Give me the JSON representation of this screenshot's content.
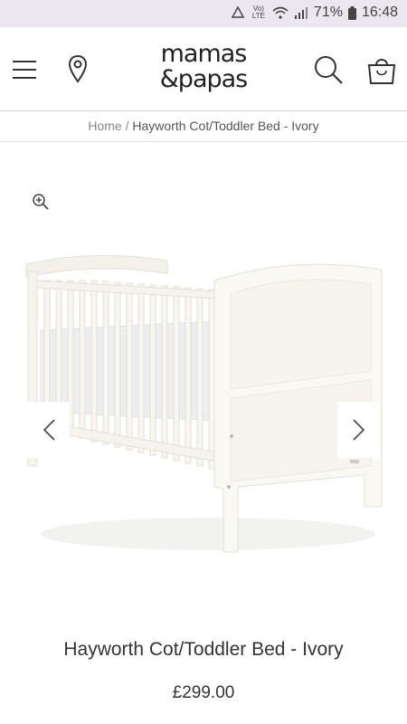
{
  "status_bar": {
    "battery_percent": "71%",
    "time": "16:48",
    "network_label": "Vo) LTE"
  },
  "header": {
    "logo_line1": "mamas",
    "logo_line2": "&papas",
    "icons": [
      "menu-icon",
      "location-pin-icon",
      "search-icon",
      "shopping-bag-icon"
    ]
  },
  "breadcrumb": {
    "home": "Home",
    "separator": "/",
    "current": "Hayworth Cot/Toddler Bed - Ivory"
  },
  "product": {
    "title": "Hayworth Cot/Toddler Bed - Ivory",
    "price": "£299.00"
  },
  "colors": {
    "status_bar_bg": "#ece7ef",
    "text": "#333333",
    "divider": "#dcdcdc"
  }
}
